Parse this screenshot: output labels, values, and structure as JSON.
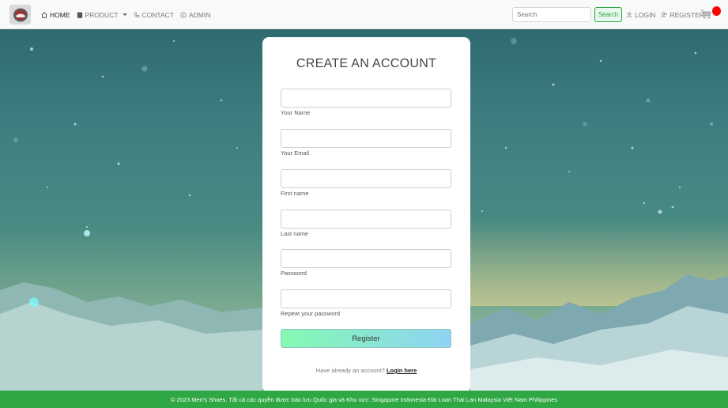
{
  "nav": {
    "items": [
      {
        "label": "HOME",
        "icon": "home-icon"
      },
      {
        "label": "PRODUCT",
        "icon": "database-icon"
      },
      {
        "label": "CONTACT",
        "icon": "phone-icon"
      },
      {
        "label": "ADMIN",
        "icon": "info-icon"
      }
    ],
    "search_placeholder": "Search",
    "search_button": "Search",
    "login": "LOGIN",
    "register": "REGISTER"
  },
  "form": {
    "title": "CREATE AN ACCOUNT",
    "fields": [
      {
        "label": "Your Name",
        "value": ""
      },
      {
        "label": "Your Email",
        "value": ""
      },
      {
        "label": "First name",
        "value": ""
      },
      {
        "label": "Last name",
        "value": ""
      },
      {
        "label": "Password",
        "value": ""
      },
      {
        "label": "Repeat your password",
        "value": ""
      }
    ],
    "submit": "Register",
    "login_prompt": "Have already an account?",
    "login_link": "Login here"
  },
  "footer": {
    "text": "© 2023 Men's Shoes. Tất cả các quyền được bảo lưu.Quốc gia và Khu vực: Singapore Indonesia Đài Loan Thái Lan Malaysia Việt Nam Philippines"
  },
  "colors": {
    "accent_green": "#28a745",
    "footer_green": "#2ea744",
    "button_gradient_start": "#84fab0",
    "button_gradient_end": "#8fd3f4",
    "cart_badge": "#ff0000"
  }
}
